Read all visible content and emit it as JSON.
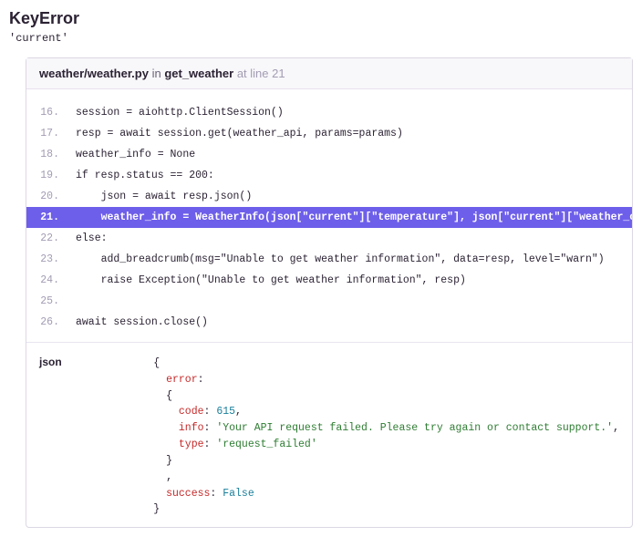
{
  "error": {
    "title": "KeyError",
    "value": "'current'"
  },
  "frame": {
    "file": "weather/weather.py",
    "in_word": "in",
    "func": "get_weather",
    "at_word": "at line",
    "line": "21"
  },
  "code": {
    "lines": [
      {
        "no": "16.",
        "text": "session = aiohttp.ClientSession()"
      },
      {
        "no": "17.",
        "text": "resp = await session.get(weather_api, params=params)"
      },
      {
        "no": "18.",
        "text": "weather_info = None"
      },
      {
        "no": "19.",
        "text": "if resp.status == 200:"
      },
      {
        "no": "20.",
        "text": "    json = await resp.json()"
      },
      {
        "no": "21.",
        "text": "    weather_info = WeatherInfo(json[\"current\"][\"temperature\"], json[\"current\"][\"weather_code\"])"
      },
      {
        "no": "22.",
        "text": "else:"
      },
      {
        "no": "23.",
        "text": "    add_breadcrumb(msg=\"Unable to get weather information\", data=resp, level=\"warn\")"
      },
      {
        "no": "24.",
        "text": "    raise Exception(\"Unable to get weather information\", resp)"
      },
      {
        "no": "25.",
        "text": ""
      },
      {
        "no": "26.",
        "text": "await session.close()"
      }
    ],
    "highlight_index": 5
  },
  "vars": {
    "name": "json",
    "json_tokens": {
      "open": "{",
      "close": "}",
      "comma": ",",
      "colon": ":",
      "error_key": "error",
      "code_key": "code",
      "code_val": "615",
      "info_key": "info",
      "info_val": "'Your API request failed. Please try again or contact support.'",
      "type_key": "type",
      "type_val": "'request_failed'",
      "success_key": "success",
      "success_val": "False"
    }
  }
}
